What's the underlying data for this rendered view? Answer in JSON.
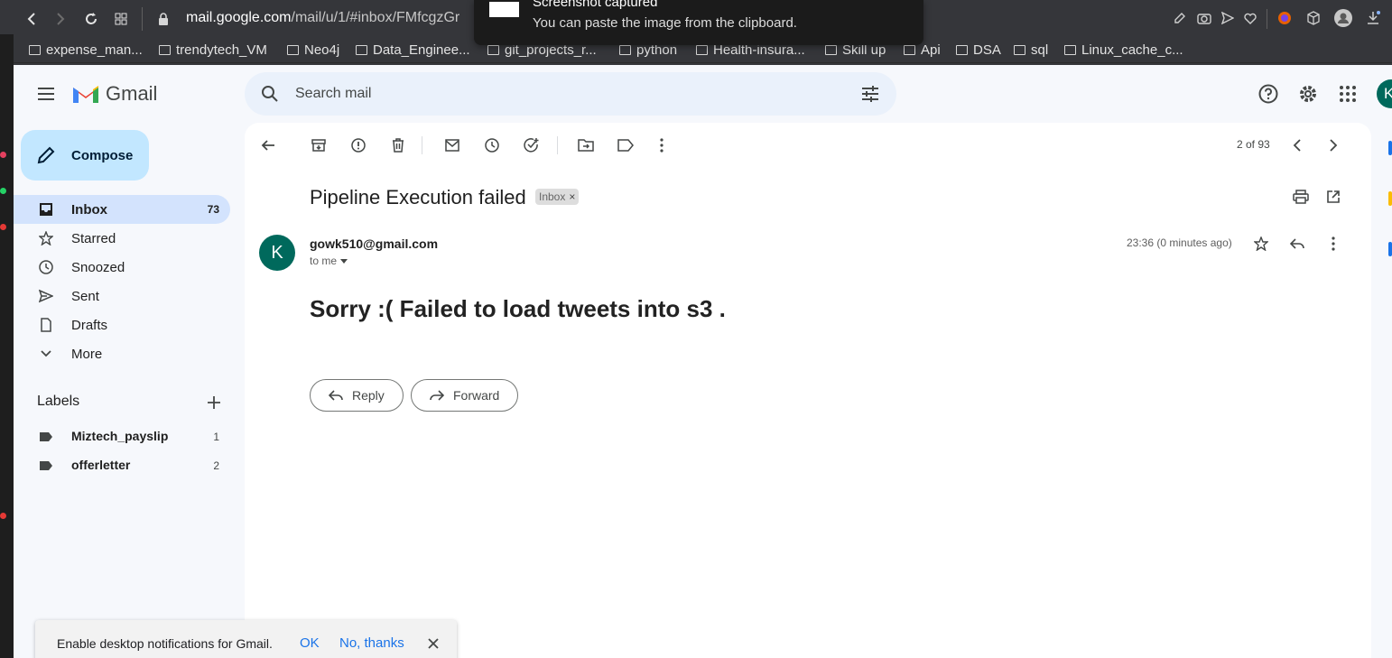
{
  "browser": {
    "url_domain": "mail.google.com",
    "url_path": "/mail/u/1/#inbox/FMfcgzGr",
    "bookmarks": [
      "expense_man...",
      "trendytech_VM",
      "Neo4j",
      "Data_Enginee...",
      "git_projects_r...",
      "python",
      "Health-insura...",
      "Skill up",
      "Api",
      "DSA",
      "sql",
      "Linux_cache_c..."
    ]
  },
  "toast": {
    "title": "Screenshot captured",
    "message": "You can paste the image from the clipboard."
  },
  "header": {
    "app_name": "Gmail",
    "search_placeholder": "Search mail",
    "avatar_letter": "K"
  },
  "sidebar": {
    "compose_label": "Compose",
    "items": [
      {
        "label": "Inbox",
        "count": "73",
        "icon": "inbox-icon"
      },
      {
        "label": "Starred",
        "count": "",
        "icon": "star-icon"
      },
      {
        "label": "Snoozed",
        "count": "",
        "icon": "clock-icon"
      },
      {
        "label": "Sent",
        "count": "",
        "icon": "send-icon"
      },
      {
        "label": "Drafts",
        "count": "",
        "icon": "draft-icon"
      },
      {
        "label": "More",
        "count": "",
        "icon": "chevron-down-icon"
      }
    ],
    "labels_title": "Labels",
    "labels": [
      {
        "label": "Miztech_payslip",
        "count": "1"
      },
      {
        "label": "offerletter",
        "count": "2"
      }
    ]
  },
  "toolbar": {
    "pager": "2 of 93"
  },
  "email": {
    "subject": "Pipeline Execution failed",
    "badge": "Inbox",
    "sender_initial": "K",
    "sender": "gowk510@gmail.com",
    "to": "to me",
    "time": "23:36 (0 minutes ago)",
    "body": "Sorry :( Failed to load tweets into s3 .",
    "reply_label": "Reply",
    "forward_label": "Forward"
  },
  "notification": {
    "text": "Enable desktop notifications for Gmail.",
    "ok": "OK",
    "no": "No, thanks"
  },
  "colors": {
    "accent": "#0b57d0",
    "compose_bg": "#c2e7ff",
    "active_nav": "#d3e3fd",
    "avatar": "#00695c"
  }
}
